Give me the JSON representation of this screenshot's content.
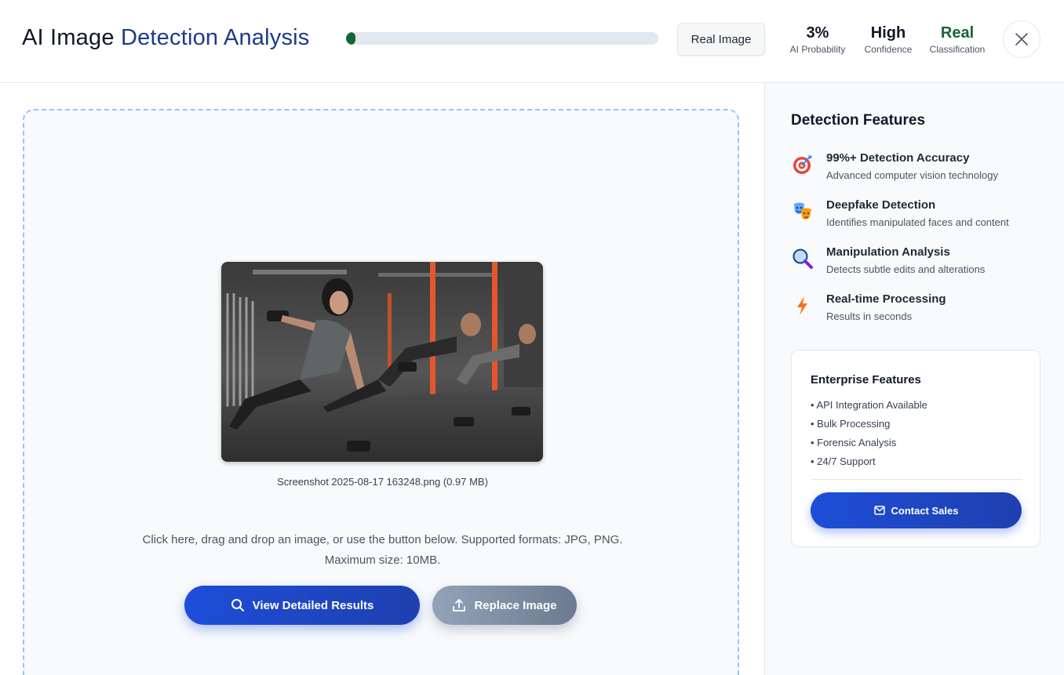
{
  "header": {
    "title_part1": "AI Image",
    "title_part2": "Detection Analysis",
    "ai_probability_fraction": 0.03,
    "result_badge": "Real Image",
    "stats": [
      {
        "value": "3%",
        "label": "AI Probability"
      },
      {
        "value": "High",
        "label": "Confidence"
      },
      {
        "value": "Real",
        "label": "Classification"
      }
    ],
    "colors": {
      "real": "#166534",
      "accent": "#1d4ed8"
    },
    "close_icon": "close-icon"
  },
  "upload": {
    "filename": "Screenshot 2025-08-17 163248.png (0.97 MB)",
    "hint_line1": "Click here, drag and drop an image, or use the button below. Supported formats: JPG, PNG.",
    "hint_line2": "Maximum size: 10MB.",
    "view_results_label": "View Detailed Results",
    "replace_label": "Replace Image",
    "view_results_icon": "search-icon",
    "replace_icon": "upload-icon"
  },
  "sidebar": {
    "title": "Detection Features",
    "features": [
      {
        "name": "99%+ Detection Accuracy",
        "desc": "Advanced computer vision technology",
        "icon": "target-icon"
      },
      {
        "name": "Deepfake Detection",
        "desc": "Identifies manipulated faces and content",
        "icon": "masks-icon"
      },
      {
        "name": "Manipulation Analysis",
        "desc": "Detects subtle edits and alterations",
        "icon": "magnifier-icon"
      },
      {
        "name": "Real-time Processing",
        "desc": "Results in seconds",
        "icon": "lightning-icon"
      }
    ],
    "enterprise": {
      "title": "Enterprise Features",
      "items": [
        "• API Integration Available",
        "• Bulk Processing",
        "• Forensic Analysis",
        "• 24/7 Support"
      ],
      "contact_label": "Contact Sales",
      "contact_icon": "mail-icon"
    }
  }
}
